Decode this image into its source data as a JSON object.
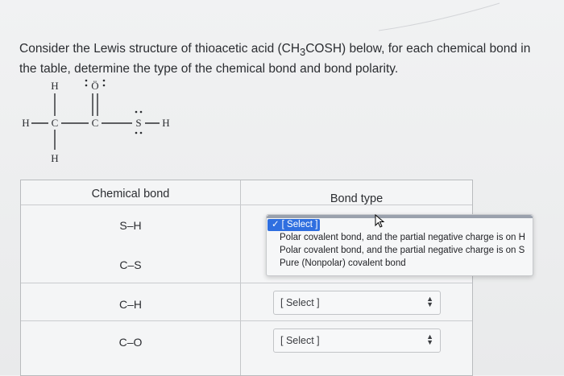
{
  "question": {
    "text_before": "Consider the Lewis structure of thioacetic acid (CH",
    "sub": "3",
    "text_after": "COSH) below, for each chemical bond in the table, determine the type of the chemical bond and bond polarity."
  },
  "lewis": {
    "atoms": [
      "H",
      "Ö",
      "H",
      "C",
      "C",
      "S",
      "H",
      "H"
    ]
  },
  "table": {
    "header_bond": "Chemical bond",
    "header_type": "Bond type",
    "rows": [
      {
        "bond": "S–H",
        "selected": "[ Select ]"
      },
      {
        "bond": "C–S",
        "selected": "[ Select ]"
      },
      {
        "bond": "C–H",
        "selected": "[ Select ]"
      },
      {
        "bond": "C–O",
        "selected": "[ Select ]"
      }
    ]
  },
  "dropdown": {
    "options": [
      "[ Select ]",
      "Polar covalent bond, and the partial negative charge is on H",
      "Polar covalent bond, and the partial negative charge is on S",
      "Pure (Nonpolar) covalent bond"
    ],
    "highlighted_index": 0
  },
  "colors": {
    "highlight": "#2f6fe0",
    "background": "#eceded"
  }
}
